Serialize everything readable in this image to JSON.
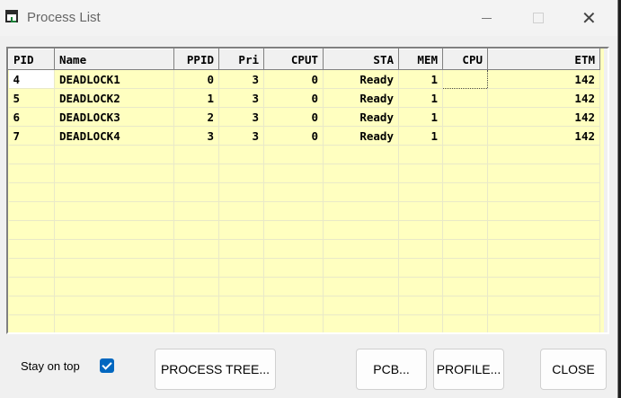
{
  "window": {
    "title": "Process List"
  },
  "grid": {
    "columns": [
      "PID",
      "Name",
      "PPID",
      "Pri",
      "CPUT",
      "STA",
      "MEM",
      "CPU",
      "ETM"
    ],
    "rows": [
      [
        "4",
        "DEADLOCK1",
        "0",
        "3",
        "0",
        "Ready",
        "1",
        "",
        "142"
      ],
      [
        "5",
        "DEADLOCK2",
        "1",
        "3",
        "0",
        "Ready",
        "1",
        "",
        "142"
      ],
      [
        "6",
        "DEADLOCK3",
        "2",
        "3",
        "0",
        "Ready",
        "1",
        "",
        "142"
      ],
      [
        "7",
        "DEADLOCK4",
        "3",
        "3",
        "0",
        "Ready",
        "1",
        "",
        "142"
      ]
    ],
    "empty_rows": 10
  },
  "footer": {
    "stay_on_top_label": "Stay on top",
    "stay_on_top_checked": true,
    "process_tree_label": "PROCESS TREE...",
    "pcb_label": "PCB...",
    "profile_label": "PROFILE...",
    "close_label": "CLOSE"
  }
}
